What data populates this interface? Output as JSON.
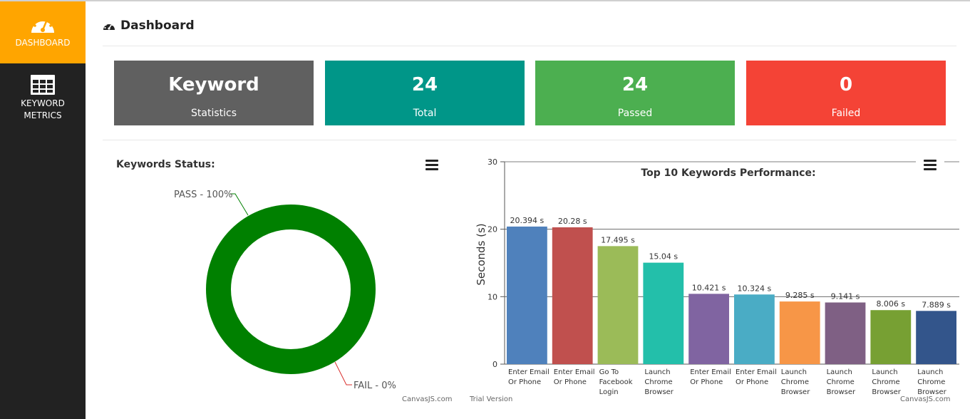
{
  "sidebar": {
    "items": [
      {
        "label": "DASHBOARD",
        "icon": "speedometer-icon",
        "active": true
      },
      {
        "label_line1": "KEYWORD",
        "label_line2": "METRICS",
        "icon": "table-grid-icon"
      }
    ],
    "active_color": "#ffa500",
    "bg_color": "#222222"
  },
  "header": {
    "title": "Dashboard",
    "icon": "dashboard-icon"
  },
  "cards": [
    {
      "value": "Keyword",
      "label": "Statistics",
      "color": "#606060"
    },
    {
      "value": "24",
      "label": "Total",
      "color": "#009688"
    },
    {
      "value": "24",
      "label": "Passed",
      "color": "#4caf50"
    },
    {
      "value": "0",
      "label": "Failed",
      "color": "#f44336"
    }
  ],
  "status_panel": {
    "title": "Keywords Status:",
    "menu_icon": "hamburger-menu-icon"
  },
  "performance_panel": {
    "menu_icon": "hamburger-menu-icon"
  },
  "chart_data": [
    {
      "type": "pie",
      "title": "Keywords Status:",
      "slices": [
        {
          "label": "PASS - 100%",
          "name": "PASS",
          "value": 100,
          "color": "#008000"
        },
        {
          "label": "FAIL - 0%",
          "name": "FAIL",
          "value": 0,
          "color": "#d9302e"
        }
      ]
    },
    {
      "type": "bar",
      "title": "Top 10 Keywords Performance:",
      "ylabel": "Seconds (s)",
      "xlabel": "",
      "ylim": [
        0,
        30
      ],
      "yticks": [
        0,
        10,
        20,
        30
      ],
      "grid": true,
      "categories": [
        [
          "Enter Email",
          "Or Phone"
        ],
        [
          "Enter Email",
          "Or Phone"
        ],
        [
          "Go To",
          "Facebook",
          "Login"
        ],
        [
          "Launch",
          "Chrome",
          "Browser"
        ],
        [
          "Enter Email",
          "Or Phone"
        ],
        [
          "Enter Email",
          "Or Phone"
        ],
        [
          "Launch",
          "Chrome",
          "Browser"
        ],
        [
          "Launch",
          "Chrome",
          "Browser"
        ],
        [
          "Launch",
          "Chrome",
          "Browser"
        ],
        [
          "Launch",
          "Chrome",
          "Browser"
        ]
      ],
      "values": [
        20.394,
        20.28,
        17.495,
        15.04,
        10.421,
        10.324,
        9.285,
        9.141,
        8.006,
        7.889
      ],
      "data_labels": [
        "20.394 s",
        "20.28 s",
        "17.495 s",
        "15.04 s",
        "10.421 s",
        "10.324 s",
        "9.285 s",
        "9.141 s",
        "8.006 s",
        "7.889 s"
      ],
      "colors": [
        "#4f81bc",
        "#c0504e",
        "#9bbb58",
        "#23bfaa",
        "#8064a1",
        "#4aacc5",
        "#f79647",
        "#7f6084",
        "#77a033",
        "#33558b"
      ]
    }
  ],
  "credits": {
    "canvasjs": "CanvasJS.com",
    "trial": "Trial Version",
    "canvasjs2": "CanvasJS.com"
  }
}
